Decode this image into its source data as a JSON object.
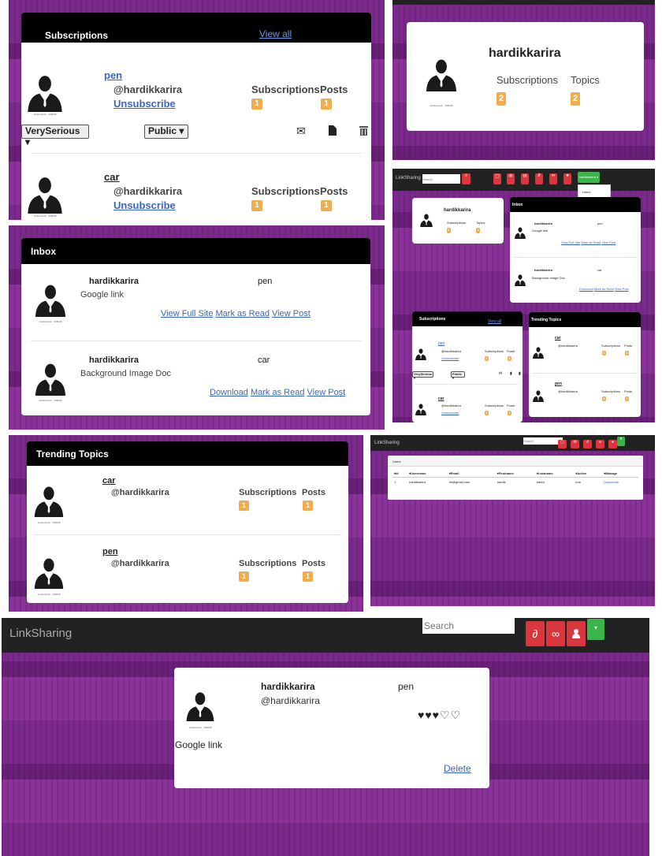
{
  "username": "hardikkarira",
  "handle": "@hardikkarira",
  "avatar_caption": "shutterstock · 308238",
  "labels": {
    "subscriptions": "Subscriptions",
    "posts": "Posts",
    "topics": "Topics"
  },
  "p1": {
    "title": "Subscriptions",
    "view_all": "View all",
    "items": [
      {
        "topic": "pen",
        "handle": "@hardikkarira",
        "action": "Unsubscribe",
        "subs": "1",
        "posts": "1",
        "seriousness": "VerySerious",
        "visibility": "Public"
      },
      {
        "topic": "car",
        "handle": "@hardikkarira",
        "action": "Unsubscribe",
        "subs": "1",
        "posts": "1"
      }
    ]
  },
  "p2": {
    "name": "hardikkarira",
    "subs_label": "Subscriptions",
    "topics_label": "Topics",
    "subs": "2",
    "topics": "2"
  },
  "p3": {
    "title": "Inbox",
    "items": [
      {
        "user": "hardikkarira",
        "topic": "pen",
        "desc": "Google link",
        "links": [
          "View Full Site",
          "Mark as Read",
          "View Post"
        ]
      },
      {
        "user": "hardikkarira",
        "topic": "car",
        "desc": "Background Image Doc",
        "links": [
          "Download",
          "Mark as Read",
          "View Post"
        ]
      }
    ]
  },
  "p4": {
    "brand": "LinkSharing",
    "search_placeholder": "Search",
    "user_menu": "hardikkarira ▾",
    "menu_items": [
      "Users",
      "Logout"
    ]
  },
  "p5": {
    "title": "Trending Topics",
    "items": [
      {
        "topic": "car",
        "handle": "@hardikkarira",
        "subs": "1",
        "posts": "1"
      },
      {
        "topic": "pen",
        "handle": "@hardikkarira",
        "subs": "1",
        "posts": "1"
      }
    ]
  },
  "p6": {
    "brand": "LinkSharing",
    "search_placeholder": "Search",
    "panel_title": "Users",
    "columns": [
      "▾Id",
      "▾Username",
      "▾Email",
      "▾Firstname",
      "▾Lastname",
      "▾Active",
      "▾Manage"
    ],
    "rows": [
      [
        "1",
        "hardikkarira",
        "hk@gmail.com",
        "hardik",
        "karira",
        "true",
        "Deactivate"
      ]
    ]
  },
  "p7": {
    "brand": "LinkSharing",
    "search_placeholder": "Search",
    "name": "hardikkarira",
    "handle": "@hardikkarira",
    "topic": "pen",
    "desc": "Google link",
    "rating": "♥♥♥♡♡",
    "delete": "Delete"
  },
  "icons": {
    "mail": "envelope-icon",
    "file": "file-icon",
    "trash": "trash-icon",
    "paperclip": "paperclip-icon",
    "link": "link-icon",
    "user": "user-icon",
    "search": "search-icon",
    "caret": "caret-icon"
  },
  "colors": {
    "badge": "#f0ad4e",
    "danger": "#d9363e",
    "success": "#3bb54a",
    "header": "#000000",
    "purple": "#7b2a8c"
  }
}
